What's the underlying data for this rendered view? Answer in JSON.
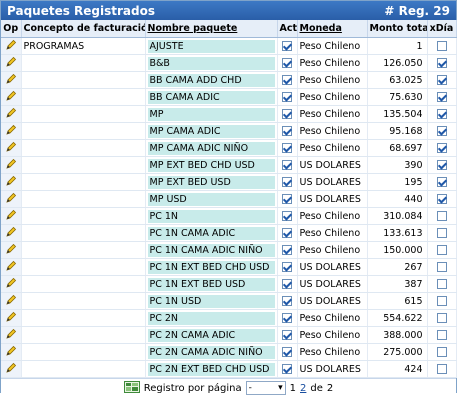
{
  "panel": {
    "title": "Paquetes Registrados",
    "count_label": "# Reg. 29"
  },
  "columns": {
    "op": "Op",
    "concepto": "Concepto de facturación",
    "nombre": "Nombre paquete",
    "act": "Act",
    "moneda": "Moneda",
    "monto": "Monto total",
    "xdia": "xDía"
  },
  "rows": [
    {
      "concepto": "PROGRAMAS",
      "nombre": "AJUSTE",
      "act": true,
      "moneda": "Peso Chileno",
      "monto": "1",
      "xdia": false
    },
    {
      "concepto": "",
      "nombre": "B&B",
      "act": true,
      "moneda": "Peso Chileno",
      "monto": "126.050",
      "xdia": true
    },
    {
      "concepto": "",
      "nombre": "BB CAMA ADD CHD",
      "act": true,
      "moneda": "Peso Chileno",
      "monto": "63.025",
      "xdia": true
    },
    {
      "concepto": "",
      "nombre": "BB CAMA ADIC",
      "act": true,
      "moneda": "Peso Chileno",
      "monto": "75.630",
      "xdia": true
    },
    {
      "concepto": "",
      "nombre": "MP",
      "act": true,
      "moneda": "Peso Chileno",
      "monto": "135.504",
      "xdia": true
    },
    {
      "concepto": "",
      "nombre": "MP CAMA ADIC",
      "act": true,
      "moneda": "Peso Chileno",
      "monto": "95.168",
      "xdia": true
    },
    {
      "concepto": "",
      "nombre": "MP CAMA ADIC NIÑO",
      "act": true,
      "moneda": "Peso Chileno",
      "monto": "68.697",
      "xdia": true
    },
    {
      "concepto": "",
      "nombre": "MP EXT BED CHD USD",
      "act": true,
      "moneda": "US DOLARES",
      "monto": "390",
      "xdia": true
    },
    {
      "concepto": "",
      "nombre": "MP EXT BED USD",
      "act": true,
      "moneda": "US DOLARES",
      "monto": "195",
      "xdia": true
    },
    {
      "concepto": "",
      "nombre": "MP USD",
      "act": true,
      "moneda": "US DOLARES",
      "monto": "440",
      "xdia": true
    },
    {
      "concepto": "",
      "nombre": "PC 1N",
      "act": true,
      "moneda": "Peso Chileno",
      "monto": "310.084",
      "xdia": false
    },
    {
      "concepto": "",
      "nombre": "PC 1N CAMA ADIC",
      "act": true,
      "moneda": "Peso Chileno",
      "monto": "133.613",
      "xdia": false
    },
    {
      "concepto": "",
      "nombre": "PC 1N CAMA ADIC NIÑO",
      "act": true,
      "moneda": "Peso Chileno",
      "monto": "150.000",
      "xdia": false
    },
    {
      "concepto": "",
      "nombre": "PC 1N EXT BED CHD USD",
      "act": true,
      "moneda": "US DOLARES",
      "monto": "267",
      "xdia": false
    },
    {
      "concepto": "",
      "nombre": "PC 1N EXT BED USD",
      "act": true,
      "moneda": "US DOLARES",
      "monto": "387",
      "xdia": false
    },
    {
      "concepto": "",
      "nombre": "PC 1N USD",
      "act": true,
      "moneda": "US DOLARES",
      "monto": "615",
      "xdia": false
    },
    {
      "concepto": "",
      "nombre": "PC 2N",
      "act": true,
      "moneda": "Peso Chileno",
      "monto": "554.622",
      "xdia": false
    },
    {
      "concepto": "",
      "nombre": "PC 2N CAMA ADIC",
      "act": true,
      "moneda": "Peso Chileno",
      "monto": "388.000",
      "xdia": false
    },
    {
      "concepto": "",
      "nombre": "PC 2N CAMA ADIC NIÑO",
      "act": true,
      "moneda": "Peso Chileno",
      "monto": "275.000",
      "xdia": false
    },
    {
      "concepto": "",
      "nombre": "PC 2N EXT BED CHD USD",
      "act": true,
      "moneda": "US DOLARES",
      "monto": "424",
      "xdia": false
    }
  ],
  "footer": {
    "label": "Registro por página",
    "select_value": "-",
    "page_current": "1",
    "page_next": "2",
    "page_sep": "de",
    "page_total": "2",
    "icon": "excel-export-icon"
  },
  "colors": {
    "title_bg": "#2a5ea8",
    "name_cell_bg": "#c8ebea",
    "header_bg": "#e6eef8"
  }
}
